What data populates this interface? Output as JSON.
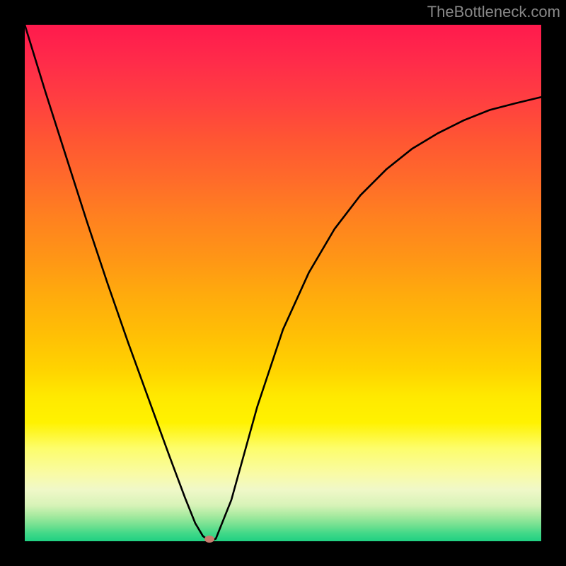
{
  "watermark": "TheBottleneck.com",
  "chart_data": {
    "type": "line",
    "title": "",
    "xlabel": "",
    "ylabel": "",
    "xlim": [
      0,
      1
    ],
    "ylim": [
      0,
      1
    ],
    "series": [
      {
        "name": "curve",
        "x": [
          0.0,
          0.04,
          0.08,
          0.12,
          0.16,
          0.2,
          0.24,
          0.28,
          0.31,
          0.33,
          0.345,
          0.358,
          0.37,
          0.4,
          0.45,
          0.5,
          0.55,
          0.6,
          0.65,
          0.7,
          0.75,
          0.8,
          0.85,
          0.9,
          0.95,
          1.0
        ],
        "y": [
          1.0,
          0.87,
          0.745,
          0.62,
          0.5,
          0.385,
          0.275,
          0.165,
          0.085,
          0.035,
          0.01,
          0.0,
          0.005,
          0.08,
          0.26,
          0.41,
          0.52,
          0.605,
          0.67,
          0.72,
          0.76,
          0.79,
          0.815,
          0.835,
          0.848,
          0.86
        ]
      }
    ],
    "marker": {
      "x": 0.358,
      "y": 0.0,
      "color": "#c97b6e"
    },
    "gradient_stops": [
      {
        "pos": 0.0,
        "color": "#ff1a4d"
      },
      {
        "pos": 0.3,
        "color": "#ff6b2a"
      },
      {
        "pos": 0.6,
        "color": "#ffbf05"
      },
      {
        "pos": 0.8,
        "color": "#fdfd6b"
      },
      {
        "pos": 0.95,
        "color": "#a8eaa0"
      },
      {
        "pos": 1.0,
        "color": "#20d082"
      }
    ]
  }
}
